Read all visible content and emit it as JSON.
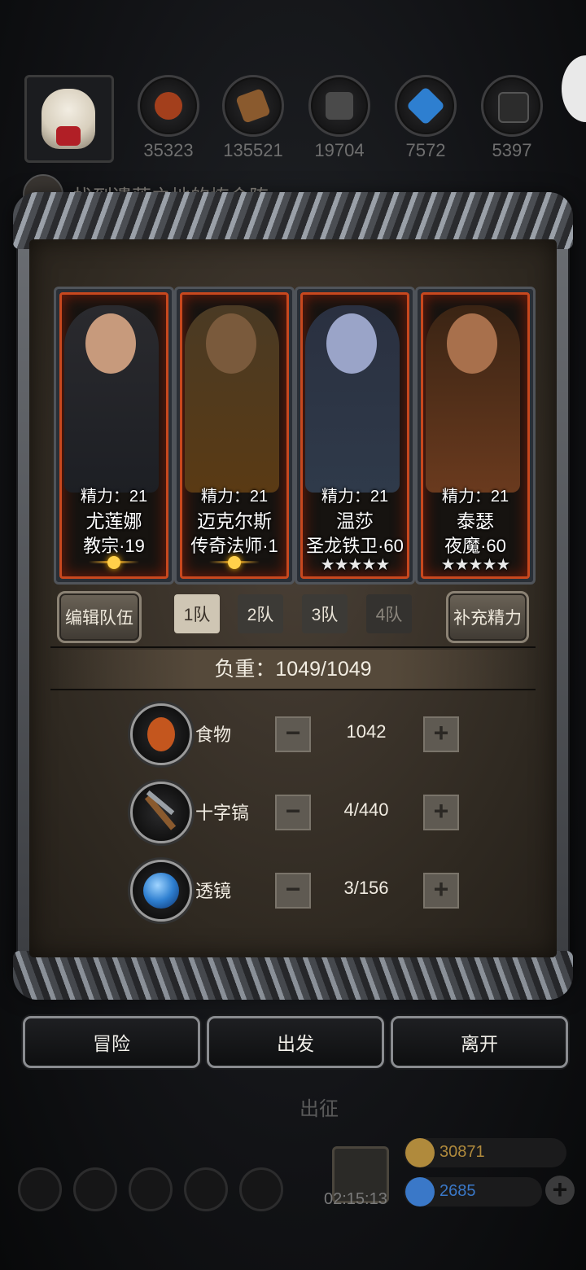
{
  "top": {
    "resources": [
      {
        "icon": "meat-icon",
        "value": "35323",
        "color": "#a33f1c"
      },
      {
        "icon": "wood-plank-icon",
        "value": "135521",
        "color": "#8a5a2e"
      },
      {
        "icon": "iron-ingot-icon",
        "value": "19704",
        "color": "#4a4a4a"
      },
      {
        "icon": "blue-crystal-icon",
        "value": "7572",
        "color": "#2e7fd0"
      },
      {
        "icon": "black-ore-icon",
        "value": "5397",
        "color": "#2c2c2c"
      }
    ],
    "quest_text": "找到遗落之地的炼金阵"
  },
  "dialog": {
    "heroes": [
      {
        "energy": "精力：21",
        "name": "尤莲娜",
        "class": "教宗·19",
        "rank": "moon",
        "skin": "#c79a7c",
        "robe": "#1d1f24"
      },
      {
        "energy": "精力：21",
        "name": "迈克尔斯",
        "class": "传奇法师·1",
        "rank": "moon",
        "skin": "#7a5a3c",
        "robe": "#5a3a14"
      },
      {
        "energy": "精力：21",
        "name": "温莎",
        "class": "圣龙铁卫·60",
        "rank": "★★★★★",
        "skin": "#9aa4c8",
        "robe": "#2f3a4a"
      },
      {
        "energy": "精力：21",
        "name": "泰瑟",
        "class": "夜魔·60",
        "rank": "★★★★★",
        "skin": "#a8704c",
        "robe": "#6a3a1e"
      }
    ],
    "edit_team": "编辑队伍",
    "tabs": [
      "1队",
      "2队",
      "3队",
      "4队"
    ],
    "active_tab": 0,
    "replenish": "补充精力",
    "load": "负重：1049/1049",
    "items": [
      {
        "icon": "meat-icon",
        "label": "食物",
        "value": "1042"
      },
      {
        "icon": "pickaxe-icon",
        "label": "十字镐",
        "value": "4/440"
      },
      {
        "icon": "lens-icon",
        "label": "透镜",
        "value": "3/156"
      }
    ],
    "minus": "−",
    "plus": "+"
  },
  "actions": {
    "adventure": "冒险",
    "depart": "出发",
    "leave": "离开"
  },
  "footer": {
    "expedition": "出征",
    "timer": "02:15:13",
    "gold": "30871",
    "gems": "2685",
    "gold_color": "#b08a3c",
    "gem_color": "#3a78c8"
  }
}
